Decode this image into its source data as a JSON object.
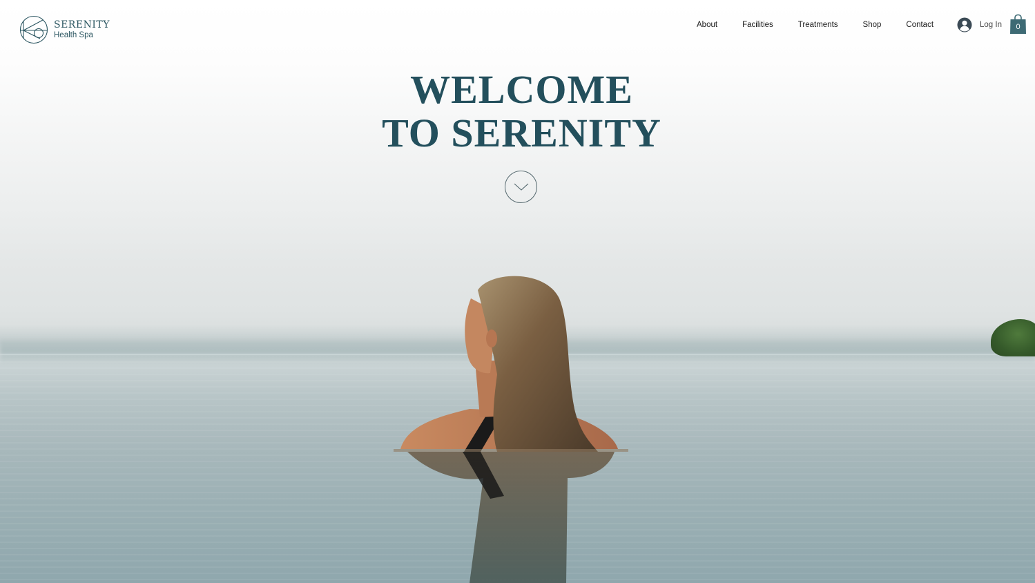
{
  "brand": {
    "name": "SERENITY",
    "tagline": "Health Spa"
  },
  "nav": {
    "items": [
      {
        "label": "About"
      },
      {
        "label": "Facilities"
      },
      {
        "label": "Treatments"
      },
      {
        "label": "Shop"
      },
      {
        "label": "Contact"
      }
    ]
  },
  "account": {
    "login_label": "Log In",
    "avatar_icon": "user-avatar-icon"
  },
  "cart": {
    "icon": "shopping-bag-icon",
    "count": "0"
  },
  "hero": {
    "title_line1": "WELCOME",
    "title_line2": "TO SERENITY",
    "scroll_icon": "chevron-down-icon"
  },
  "colors": {
    "brand_teal": "#234f5c",
    "cart_teal": "#3d6a74",
    "nav_text": "#1c1c1c"
  }
}
